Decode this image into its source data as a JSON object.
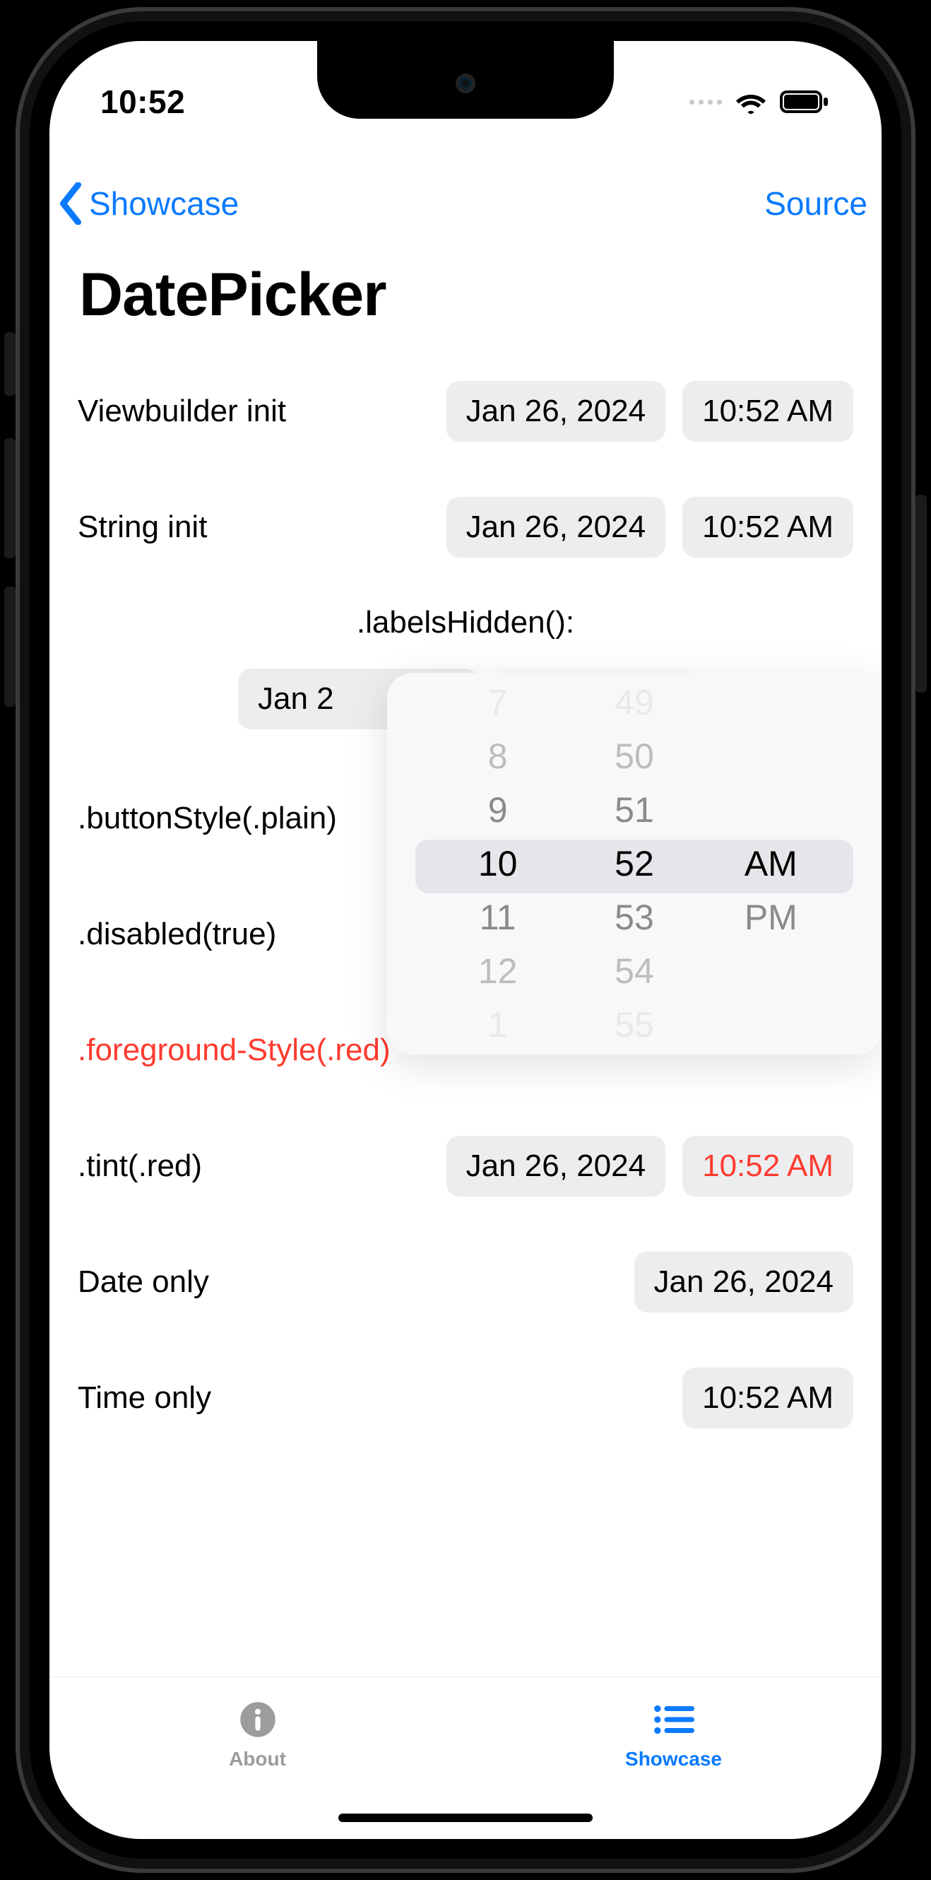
{
  "status": {
    "time": "10:52"
  },
  "nav": {
    "back_label": "Showcase",
    "right_label": "Source"
  },
  "title": "DatePicker",
  "date_default": "Jan 26, 2024",
  "time_default": "10:52 AM",
  "rows": {
    "viewbuilder": {
      "label": "Viewbuilder init",
      "date": "Jan 26, 2024",
      "time": "10:52 AM"
    },
    "stringinit": {
      "label": "String init",
      "date": "Jan 26, 2024",
      "time": "10:52 AM"
    },
    "labelshidden_caption": ".labelsHidden():",
    "labelshidden_date_truncated": "Jan 2",
    "buttonstyle": {
      "label": ".buttonStyle(.plain)"
    },
    "disabled": {
      "label": ".disabled(true)"
    },
    "foreground": {
      "label": ".foreground-Style(.red)"
    },
    "tint": {
      "label": ".tint(.red)",
      "date": "Jan 26, 2024",
      "time": "10:52 AM"
    },
    "dateonly": {
      "label": "Date only",
      "date": "Jan 26, 2024"
    },
    "timeonly": {
      "label": "Time only",
      "time": "10:52 AM"
    }
  },
  "picker": {
    "hours": [
      "7",
      "8",
      "9",
      "10",
      "11",
      "12",
      "1"
    ],
    "minutes": [
      "49",
      "50",
      "51",
      "52",
      "53",
      "54",
      "55"
    ],
    "ampm": [
      "AM",
      "PM"
    ],
    "selected_hour": "10",
    "selected_minute": "52",
    "selected_ampm": "AM"
  },
  "tabs": {
    "about": {
      "label": "About"
    },
    "showcase": {
      "label": "Showcase"
    }
  }
}
